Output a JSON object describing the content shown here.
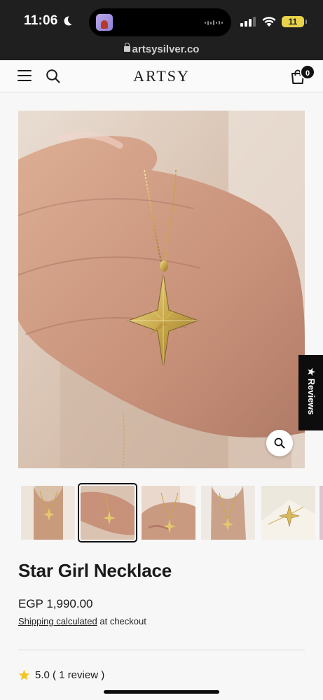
{
  "status_bar": {
    "time": "11:06",
    "battery": "11",
    "url": "artsysilver.co"
  },
  "header": {
    "logo": "ARTSY",
    "cart_count": "0"
  },
  "reviews_tab": {
    "label": "★ Reviews"
  },
  "product": {
    "title": "Star Girl Necklace",
    "price": "EGP 1,990.00",
    "shipping_link": "Shipping calculated",
    "shipping_suffix": " at checkout",
    "rating": "5.0 ( 1 review )",
    "thumbnail_count": 5,
    "selected_thumbnail": 2
  },
  "colors": {
    "status_bg": "#1f1f1f",
    "page_bg": "#f7f7f7",
    "gold": "#c9a84a",
    "star_rating": "#f3c623",
    "battery": "#e9d34a"
  },
  "icons": [
    "moon-icon",
    "signal-icon",
    "wifi-icon",
    "lock-icon",
    "menu-icon",
    "search-icon",
    "cart-icon",
    "zoom-icon",
    "star-icon"
  ]
}
